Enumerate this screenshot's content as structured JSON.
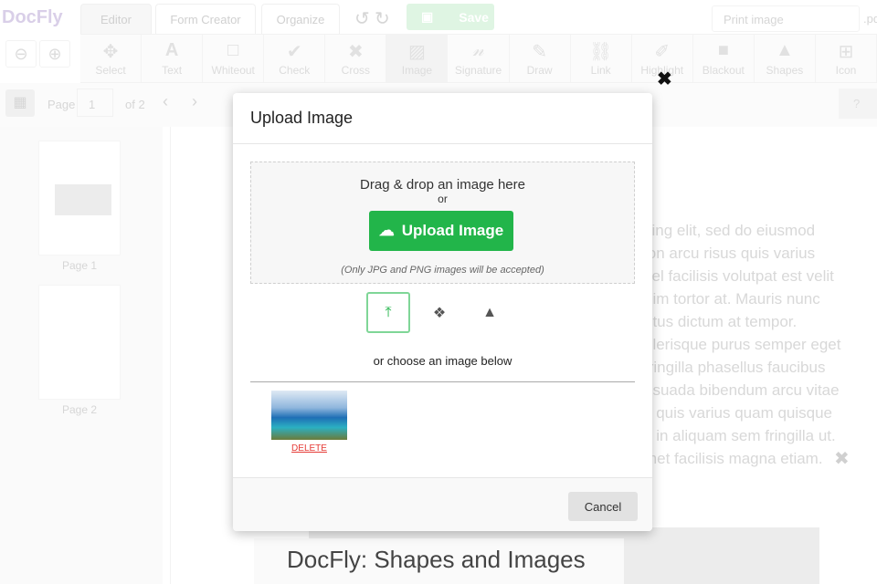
{
  "app": {
    "logo": "DocFly",
    "tabs": [
      "Editor",
      "Form Creator",
      "Organize"
    ],
    "save_label": "Save",
    "filename_placeholder": "Print image",
    "file_ext": ".pd"
  },
  "toolbar": {
    "tools": [
      "Select",
      "Text",
      "Whiteout",
      "Check",
      "Cross",
      "Image",
      "Signature",
      "Draw",
      "Link",
      "Highlight",
      "Blackout",
      "Shapes",
      "Icon"
    ]
  },
  "pager": {
    "label": "Page",
    "current": "1",
    "of": "of 2"
  },
  "sidebar": {
    "pages": [
      "Page 1",
      "Page 2"
    ]
  },
  "document": {
    "lines": [
      "cing elit, sed do eiusmod",
      "lon arcu risus quis varius",
      "vel facilisis volutpat est velit",
      "nim tortor at. Mauris nunc",
      "etus dictum at tempor.",
      "elerisque purus semper eget",
      "fringilla phasellus faucibus",
      "esuada bibendum arcu vitae",
      "s quis varius quam quisque",
      "s in aliquam sem fringilla ut.",
      "met facilisis magna etiam."
    ],
    "heading": "DocFly:  Shapes and Images"
  },
  "modal": {
    "title": "Upload Image",
    "drag_text": "Drag & drop an image here",
    "or": "or",
    "upload_label": "Upload Image",
    "note": "(Only JPG and PNG images will be accepted)",
    "choose_text": "or choose an image below",
    "delete_label": "DELETE",
    "cancel_label": "Cancel"
  },
  "colors": {
    "accent": "#22b54a",
    "delete": "#e53935"
  }
}
